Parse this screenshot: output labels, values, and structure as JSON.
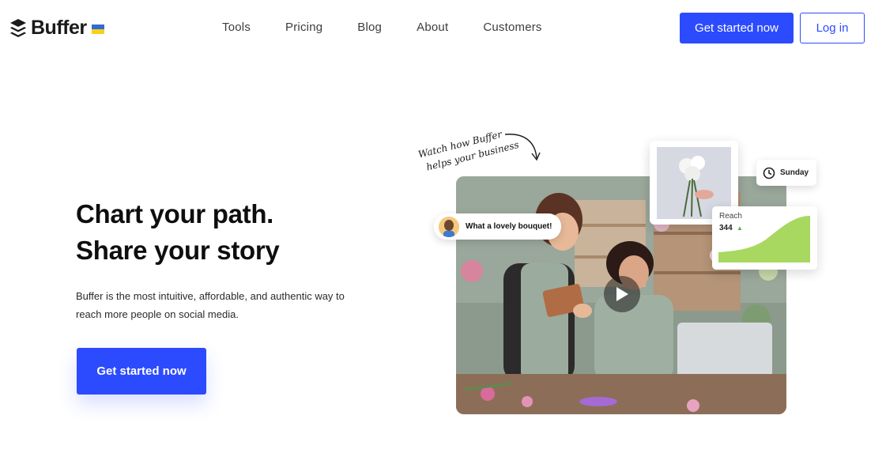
{
  "brand": {
    "name": "Buffer"
  },
  "nav": {
    "items": [
      "Tools",
      "Pricing",
      "Blog",
      "About",
      "Customers"
    ]
  },
  "header": {
    "cta_label": "Get started now",
    "login_label": "Log in"
  },
  "hero": {
    "title_line1": "Chart your path.",
    "title_line2": "Share your story",
    "body": "Buffer is the most intuitive, affordable, and authentic way to reach more people on social media.",
    "cta_label": "Get started now"
  },
  "media": {
    "watch_line1": "Watch how Buffer",
    "watch_line2": "helps your business",
    "comment_text": "What a lovely bouquet!",
    "schedule_day": "Sunday",
    "reach_label": "Reach",
    "reach_value": "344"
  },
  "colors": {
    "accent": "#2c4bff",
    "reach_fill": "#a8d860",
    "flag_blue": "#2f6bd8",
    "flag_yellow": "#f7d117"
  },
  "icons": [
    "buffer-logo-icon",
    "ukraine-flag-icon",
    "play-icon",
    "clock-icon",
    "arrow-up-icon",
    "curved-arrow-icon"
  ]
}
